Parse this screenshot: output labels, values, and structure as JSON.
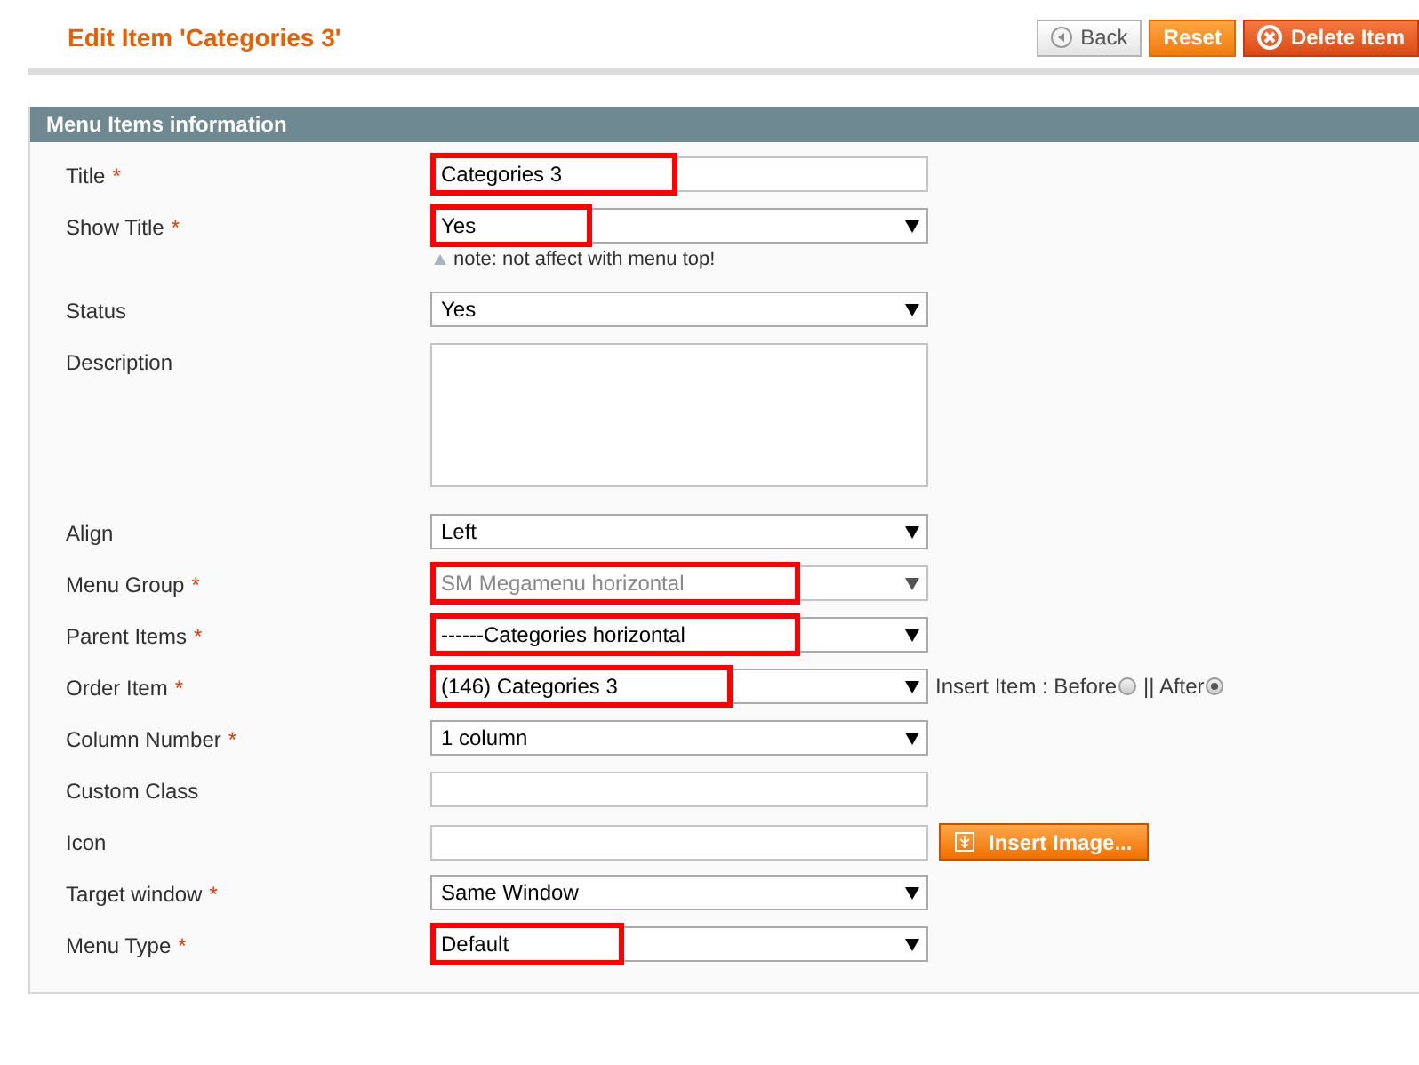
{
  "header": {
    "title": "Edit Item 'Categories 3'",
    "buttons": [
      {
        "label": "Back",
        "kind": "back"
      },
      {
        "label": "Reset",
        "kind": "reset"
      },
      {
        "label": "Delete Item",
        "kind": "delete"
      }
    ]
  },
  "panel": {
    "title": "Menu Items information",
    "fields": [
      {
        "label": "Title",
        "required_mark": "*",
        "kind": "text",
        "value": "Categories 3",
        "highlighted": true
      },
      {
        "label": "Show Title",
        "required_mark": "*",
        "kind": "select",
        "value": "Yes",
        "highlighted": true,
        "note": "note: not affect with menu top!"
      },
      {
        "label": "Status",
        "kind": "select",
        "value": "Yes",
        "highlighted": false
      },
      {
        "label": "Description",
        "kind": "textarea",
        "highlighted": false
      },
      {
        "label": "Align",
        "kind": "select",
        "value": "Left",
        "highlighted": false
      },
      {
        "label": "Menu Group",
        "required_mark": "*",
        "kind": "select",
        "value": "SM Megamenu horizontal",
        "highlighted": true,
        "disabled": true
      },
      {
        "label": "Parent Items",
        "required_mark": "*",
        "kind": "select",
        "value": "------Categories horizontal",
        "highlighted": true
      },
      {
        "label": "Order Item",
        "required_mark": "*",
        "kind": "select",
        "value": "(146) Categories 3",
        "highlighted": true,
        "options": [
          {
            "label": "Insert Item : Before",
            "selected": false
          },
          {
            "label": "|| After",
            "selected": true
          }
        ]
      },
      {
        "label": "Column Number",
        "required_mark": "*",
        "kind": "select",
        "value": "1 column",
        "highlighted": false
      },
      {
        "label": "Custom Class",
        "kind": "text",
        "highlighted": false
      },
      {
        "label": "Icon",
        "kind": "text",
        "highlighted": false,
        "button": "Insert Image..."
      },
      {
        "label": "Target window",
        "required_mark": "*",
        "kind": "select",
        "value": "Same Window",
        "highlighted": false
      },
      {
        "label": "Menu Type",
        "required_mark": "*",
        "kind": "select",
        "value": "Default",
        "highlighted": true
      }
    ]
  }
}
